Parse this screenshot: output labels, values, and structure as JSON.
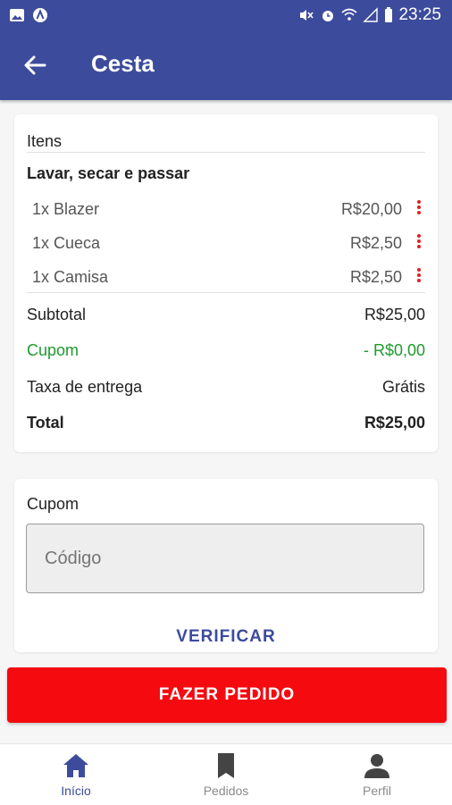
{
  "status_bar": {
    "time": "23:25",
    "left_icons": [
      "image-icon",
      "a-circle-icon"
    ],
    "right_icons": [
      "mute-icon",
      "alarm-icon",
      "wifi-icon",
      "signal-icon",
      "battery-icon"
    ]
  },
  "app_bar": {
    "title": "Cesta",
    "back_icon": "arrow-back-icon"
  },
  "basket": {
    "section_label": "Itens",
    "service_name": "Lavar, secar e passar",
    "items": [
      {
        "qty_name": "1x Blazer",
        "price": "R$20,00"
      },
      {
        "qty_name": "1x Cueca",
        "price": "R$2,50"
      },
      {
        "qty_name": "1x Camisa",
        "price": "R$2,50"
      }
    ],
    "subtotal_label": "Subtotal",
    "subtotal_value": "R$25,00",
    "coupon_label": "Cupom",
    "coupon_value": "- R$0,00",
    "delivery_label": "Taxa de entrega",
    "delivery_value": "Grátis",
    "total_label": "Total",
    "total_value": "R$25,00"
  },
  "coupon": {
    "label": "Cupom",
    "placeholder": "Código",
    "verify_label": "VERIFICAR"
  },
  "order_button": "FAZER PEDIDO",
  "bottom_nav": [
    {
      "label": "Início",
      "icon": "home-icon",
      "active": true
    },
    {
      "label": "Pedidos",
      "icon": "bookmark-icon",
      "active": false
    },
    {
      "label": "Perfil",
      "icon": "person-icon",
      "active": false
    }
  ],
  "colors": {
    "primary": "#3c4b9c",
    "accent_red": "#f50a10",
    "coupon_green": "#1f9a2f"
  }
}
